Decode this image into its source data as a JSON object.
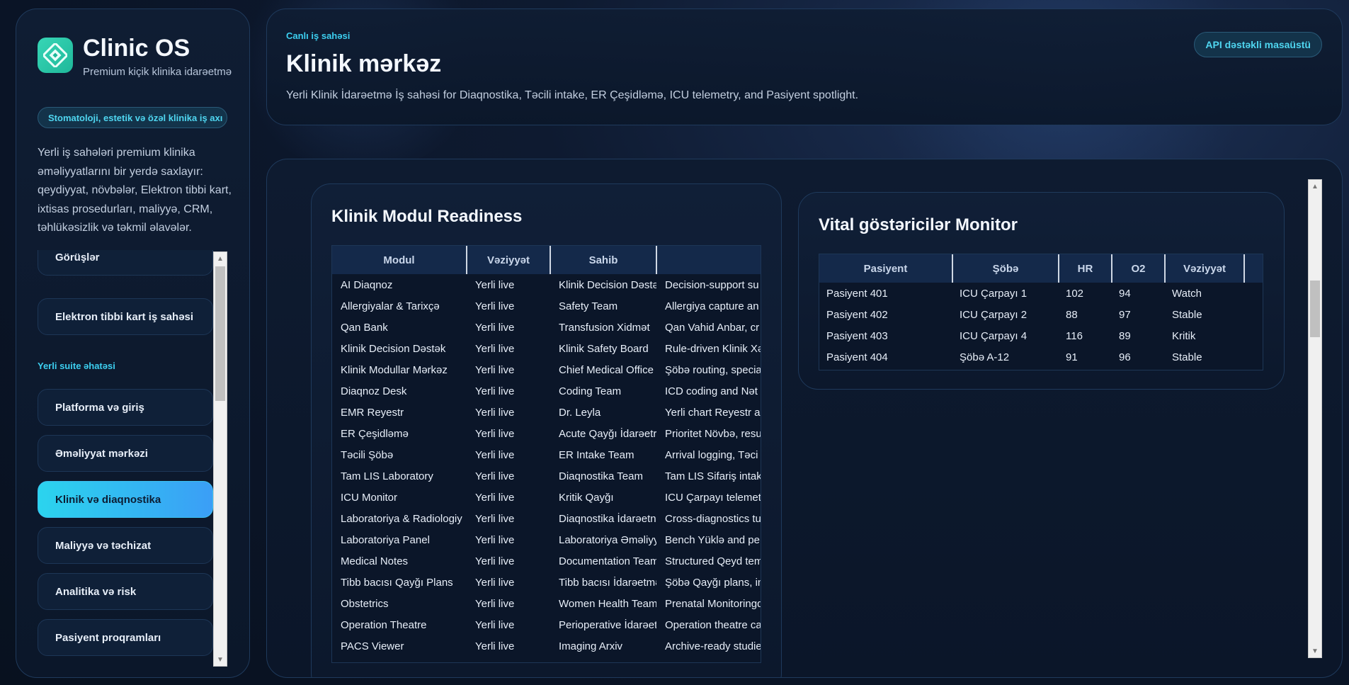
{
  "sidebar": {
    "app_title": "Clinic OS",
    "app_subtitle": "Premium kiçik klinika idarəetmə",
    "pill": "Stomatoloji, estetik və özəl klinika iş axı",
    "description": "Yerli iş sahələri premium klinika əməliyyatlarını bir yerdə saxlayır: qeydiyyat, növbələr, Elektron tibbi kart, ixtisas prosedurları, maliyyə, CRM, təhlükəsizlik və təkmil əlavələr.",
    "items": [
      {
        "label": "Görüşlər"
      },
      {
        "label": "Elektron tibbi kart iş sahəsi"
      },
      {
        "label": "Platforma və giriş"
      },
      {
        "label": "Əməliyyat mərkəzi"
      },
      {
        "label": "Klinik və diaqnostika",
        "active": true
      },
      {
        "label": "Maliyyə və təchizat"
      },
      {
        "label": "Analitika və risk"
      },
      {
        "label": "Pasiyent proqramları"
      }
    ],
    "section_label": "Yerli suite əhatəsi"
  },
  "header": {
    "eyebrow": "Canlı iş sahəsi",
    "title": "Klinik mərkəz",
    "description": "Yerli Klinik İdarəetmə İş sahəsi for Diaqnostika, Təcili intake, ER Çeşidləmə, ICU telemetry, and Pasiyent spotlight.",
    "api_badge": "API dəstəkli masaüstü"
  },
  "modules_panel": {
    "title": "Klinik Modul Readiness",
    "columns": [
      "Modul",
      "Vəziyyət",
      "Sahib",
      ""
    ],
    "rows": [
      [
        "AI Diaqnoz",
        "Yerli live",
        "Klinik Decision Dəstə",
        "Decision-support su"
      ],
      [
        "Allergiyalar & Tarixçə",
        "Yerli live",
        "Safety Team",
        "Allergiya capture an"
      ],
      [
        "Qan Bank",
        "Yerli live",
        "Transfusion Xidmət",
        "Qan Vahid Anbar, cr"
      ],
      [
        "Klinik Decision Dəstək",
        "Yerli live",
        "Klinik Safety Board",
        "Rule-driven Klinik Xə"
      ],
      [
        "Klinik Modullar Mərkəz",
        "Yerli live",
        "Chief Medical Office",
        "Şöbə routing, specia"
      ],
      [
        "Diaqnoz Desk",
        "Yerli live",
        "Coding Team",
        "ICD coding and Nət"
      ],
      [
        "EMR Reyestr",
        "Yerli live",
        "Dr. Leyla",
        "Yerli chart Reyestr a"
      ],
      [
        "ER Çeşidləmə",
        "Yerli live",
        "Acute Qayğı İdarəetr",
        "Prioritet Növbə, resu"
      ],
      [
        "Təcili Şöbə",
        "Yerli live",
        "ER Intake Team",
        "Arrival logging, Təci"
      ],
      [
        "Tam LIS Laboratory",
        "Yerli live",
        "Diaqnostika Team",
        "Tam LIS Sifariş intake"
      ],
      [
        "ICU Monitor",
        "Yerli live",
        "Kritik Qayğı",
        "ICU Çarpayı telemet"
      ],
      [
        "Laboratoriya & Radiologiy",
        "Yerli live",
        "Diaqnostika İdarəetn",
        "Cross-diagnostics tu"
      ],
      [
        "Laboratoriya Panel",
        "Yerli live",
        "Laboratoriya Əməliyy",
        "Bench Yüklə and per"
      ],
      [
        "Medical Notes",
        "Yerli live",
        "Documentation Team",
        "Structured Qeyd tem"
      ],
      [
        "Tibb bacısı Qayğı Plans",
        "Yerli live",
        "Tibb bacısı İdarəetmə",
        "Şöbə Qayğı plans, in"
      ],
      [
        "Obstetrics",
        "Yerli live",
        "Women Health Team",
        "Prenatal Monitoringq"
      ],
      [
        "Operation Theatre",
        "Yerli live",
        "Perioperative İdarəet",
        "Operation theatre ca"
      ],
      [
        "PACS Viewer",
        "Yerli live",
        "Imaging Arxiv",
        "Archive-ready studie"
      ]
    ]
  },
  "vitals_panel": {
    "title": "Vital göstəricilər Monitor",
    "columns": [
      "Pasiyent",
      "Şöbə",
      "HR",
      "O2",
      "Vəziyyət"
    ],
    "rows": [
      [
        "Pasiyent 401",
        "ICU Çarpayı 1",
        "102",
        "94",
        "Watch"
      ],
      [
        "Pasiyent 402",
        "ICU Çarpayı 2",
        "88",
        "97",
        "Stable"
      ],
      [
        "Pasiyent 403",
        "ICU Çarpayı 4",
        "116",
        "89",
        "Kritik"
      ],
      [
        "Pasiyent 404",
        "Şöbə A-12",
        "91",
        "96",
        "Stable"
      ]
    ]
  },
  "icons": {
    "logo": "clinic-logo-icon",
    "scroll_up": "chevron-up-icon",
    "scroll_down": "chevron-down-icon"
  },
  "colors": {
    "accent": "#3ccff0",
    "active_start": "#2bd4ee",
    "active_end": "#3b9ef6",
    "logo": "#37d6b6"
  }
}
